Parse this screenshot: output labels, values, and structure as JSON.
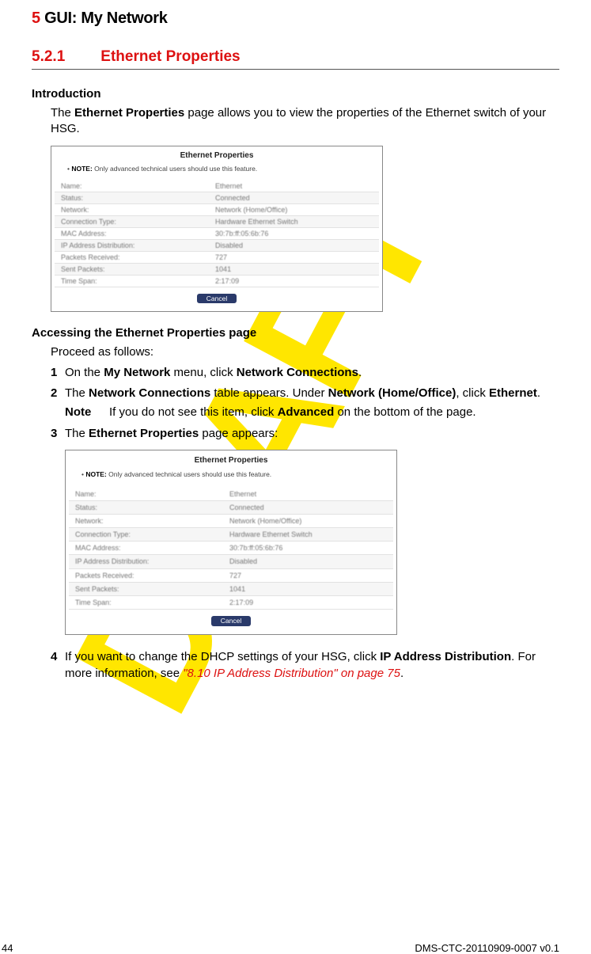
{
  "header": {
    "chapnum": "5",
    "chaptitle": "GUI: My Network"
  },
  "section": {
    "number": "5.2.1",
    "title": "Ethernet Properties"
  },
  "intro_h": "Introduction",
  "intro_p_pre": "The ",
  "intro_p_bold": "Ethernet Properties",
  "intro_p_post": " page allows you to view the properties of the Ethernet switch of your HSG.",
  "access_h": "Accessing the Ethernet Properties page",
  "access_lead": "Proceed as follows:",
  "steps": {
    "s1_a": "On the ",
    "s1_b": "My Network",
    "s1_c": " menu, click ",
    "s1_d": "Network Connections",
    "s1_e": ".",
    "s2_a": "The ",
    "s2_b": "Network Connections",
    "s2_c": " table appears. Under ",
    "s2_d": "Network (Home/Office)",
    "s2_e": ", click ",
    "s2_f": "Ethernet",
    "s2_g": ".",
    "note_label": "Note",
    "note_a": "If you do not see this item, click ",
    "note_b": "Advanced",
    "note_c": " on the bottom of the page.",
    "s3_a": "The ",
    "s3_b": "Ethernet Properties",
    "s3_c": " page appears:",
    "s4_a": "If you want to change the DHCP settings of your HSG, click ",
    "s4_b": "IP Address Distribution",
    "s4_c": ". For more information, see ",
    "s4_xref": "\"8.10 IP Address Distribution\" on page 75",
    "s4_d": "."
  },
  "shot": {
    "title": "Ethernet Properties",
    "note_b": "NOTE:",
    "note_t": " Only advanced technical users should use this feature.",
    "rows": [
      {
        "k": "Name:",
        "v": "Ethernet"
      },
      {
        "k": "Status:",
        "v": "Connected",
        "cls": "connected"
      },
      {
        "k": "Network:",
        "v": "Network (Home/Office)"
      },
      {
        "k": "Connection Type:",
        "v": "Hardware Ethernet Switch"
      },
      {
        "k": "MAC Address:",
        "v": "30:7b:ff:05:6b:76"
      },
      {
        "k": "IP Address Distribution:",
        "v": "Disabled"
      },
      {
        "k": "Packets Received:",
        "v": "727"
      },
      {
        "k": "Sent Packets:",
        "v": "1041"
      },
      {
        "k": "Time Span:",
        "v": "2:17:09"
      }
    ],
    "btn": "Cancel"
  },
  "footer": {
    "page": "44",
    "docid": "DMS-CTC-20110909-0007 v0.1"
  }
}
